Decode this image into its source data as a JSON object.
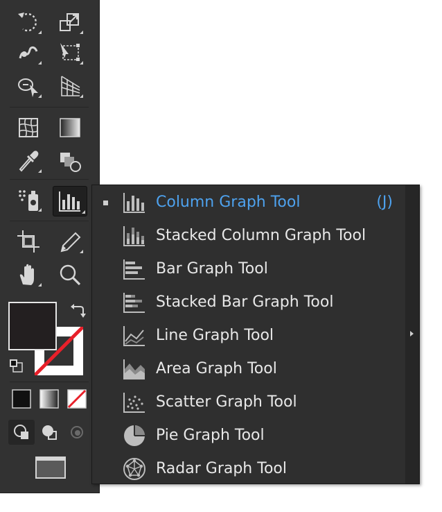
{
  "toolbar": {
    "tools": [
      {
        "name": "rotate-tool",
        "icon": "rotate-icon"
      },
      {
        "name": "scale-tool",
        "icon": "scale-icon"
      },
      {
        "name": "warp-tool",
        "icon": "warp-icon"
      },
      {
        "name": "free-transform-tool",
        "icon": "free-transform-icon"
      },
      {
        "name": "shape-builder-tool",
        "icon": "shape-builder-icon"
      },
      {
        "name": "perspective-grid-tool",
        "icon": "perspective-grid-icon"
      },
      {
        "name": "mesh-tool",
        "icon": "mesh-icon"
      },
      {
        "name": "gradient-tool",
        "icon": "gradient-icon"
      },
      {
        "name": "eyedropper-tool",
        "icon": "eyedropper-icon"
      },
      {
        "name": "blend-tool",
        "icon": "blend-icon"
      },
      {
        "name": "symbol-sprayer-tool",
        "icon": "symbol-sprayer-icon"
      },
      {
        "name": "column-graph-tool",
        "icon": "column-graph-icon"
      },
      {
        "name": "artboard-tool",
        "icon": "artboard-icon"
      },
      {
        "name": "slice-tool",
        "icon": "slice-icon"
      },
      {
        "name": "hand-tool",
        "icon": "hand-icon"
      },
      {
        "name": "zoom-tool",
        "icon": "zoom-icon"
      }
    ],
    "fill_color": "#231f20",
    "stroke_color": "none",
    "none_slash_color": "#e8202a"
  },
  "flyout": {
    "items": [
      {
        "label": "Column Graph Tool",
        "shortcut": "(J)",
        "icon": "column-graph-icon",
        "selected": true
      },
      {
        "label": "Stacked Column Graph Tool",
        "icon": "stacked-column-graph-icon"
      },
      {
        "label": "Bar Graph Tool",
        "icon": "bar-graph-icon"
      },
      {
        "label": "Stacked Bar Graph Tool",
        "icon": "stacked-bar-graph-icon"
      },
      {
        "label": "Line Graph Tool",
        "icon": "line-graph-icon"
      },
      {
        "label": "Area Graph Tool",
        "icon": "area-graph-icon"
      },
      {
        "label": "Scatter Graph Tool",
        "icon": "scatter-graph-icon"
      },
      {
        "label": "Pie Graph Tool",
        "icon": "pie-graph-icon"
      },
      {
        "label": "Radar Graph Tool",
        "icon": "radar-graph-icon"
      }
    ],
    "selected_color": "#4ea2ee",
    "text_color": "#e8e8e8"
  }
}
